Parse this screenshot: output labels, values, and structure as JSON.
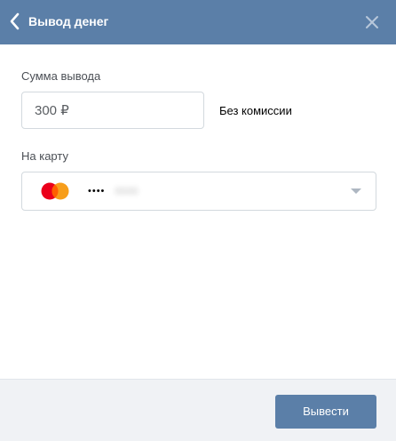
{
  "header": {
    "title": "Вывод денег",
    "back_icon": "chevron-left-icon",
    "close_icon": "close-icon"
  },
  "form": {
    "amount": {
      "label": "Сумма вывода",
      "value": "300 ₽"
    },
    "commission_note": "Без комиссии",
    "card": {
      "label": "На карту",
      "brand_icon": "mastercard-icon",
      "masked_number": "••••",
      "dropdown_icon": "caret-down-icon"
    }
  },
  "footer": {
    "submit_label": "Вывести"
  },
  "colors": {
    "header_bg": "#5b7fa8",
    "button_bg": "#5b7fa8",
    "footer_bg": "#f0f2f5",
    "input_border": "#d3d9de",
    "mastercard_red": "#eb001b",
    "mastercard_orange": "#f79e1b"
  }
}
